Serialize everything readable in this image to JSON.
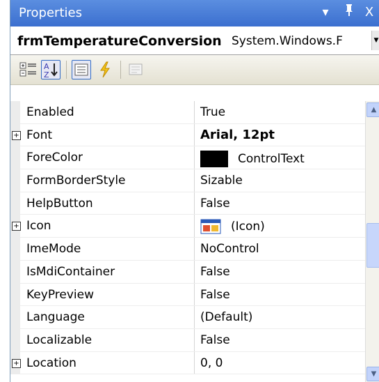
{
  "window": {
    "title": "Properties",
    "buttons": {
      "dropdown": "▾",
      "pin": "ф",
      "close": "X"
    }
  },
  "selector": {
    "object_name": "frmTemperatureConversion",
    "object_type": "System.Windows.F "
  },
  "toolbar": {
    "buttons": [
      "categorized-view",
      "alphabetical-view",
      "properties",
      "events",
      "property-pages"
    ]
  },
  "properties": [
    {
      "name": "Enabled",
      "value": "True",
      "expandable": false
    },
    {
      "name": "Font",
      "value": "Arial, 12pt",
      "expandable": true,
      "bold": true
    },
    {
      "name": "ForeColor",
      "value": "ControlText",
      "expandable": false,
      "swatch_color": "#000000"
    },
    {
      "name": "FormBorderStyle",
      "value": "Sizable",
      "expandable": false
    },
    {
      "name": "HelpButton",
      "value": "False",
      "expandable": false
    },
    {
      "name": "Icon",
      "value": "(Icon)",
      "expandable": true,
      "icon": "form-icon"
    },
    {
      "name": "ImeMode",
      "value": "NoControl",
      "expandable": false
    },
    {
      "name": "IsMdiContainer",
      "value": "False",
      "expandable": false
    },
    {
      "name": "KeyPreview",
      "value": "False",
      "expandable": false
    },
    {
      "name": "Language",
      "value": "(Default)",
      "expandable": false
    },
    {
      "name": "Localizable",
      "value": "False",
      "expandable": false
    },
    {
      "name": "Location",
      "value": "0, 0",
      "expandable": true
    }
  ],
  "colors": {
    "titlebar": "#4a7fd9",
    "selection": "#316ac5"
  }
}
